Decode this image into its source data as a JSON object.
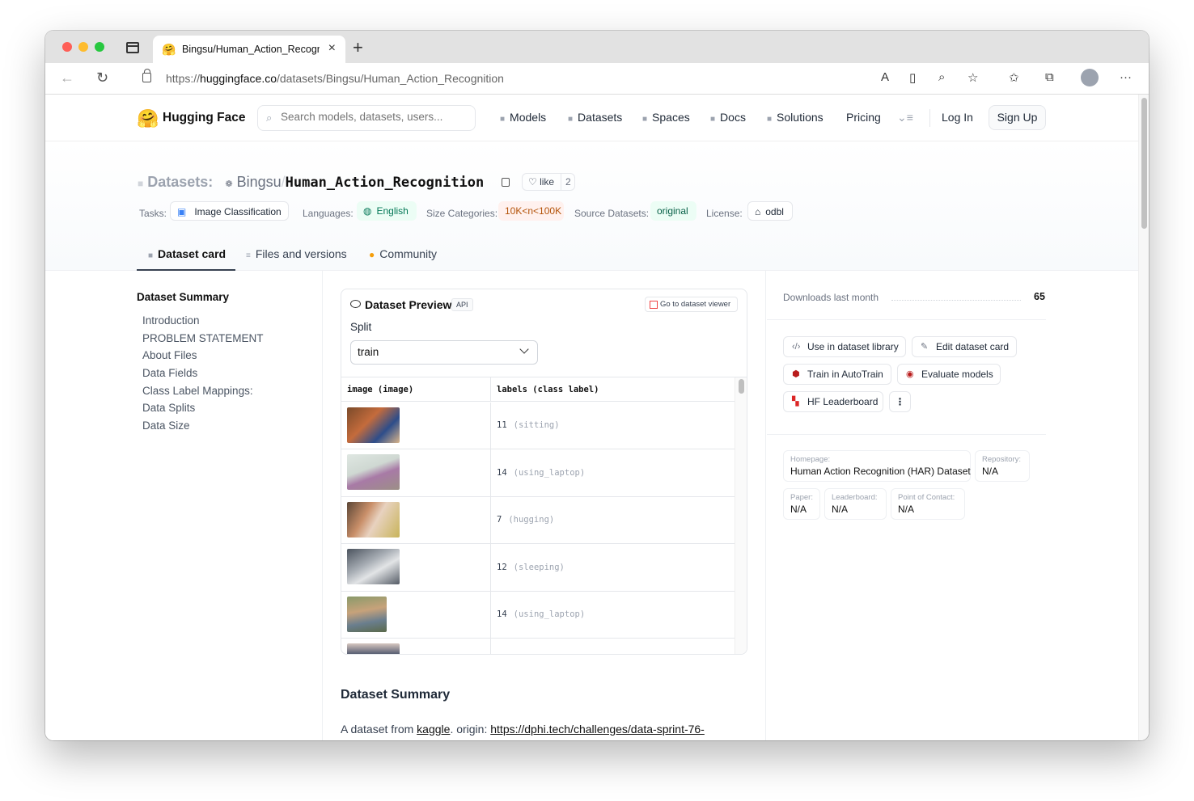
{
  "browser": {
    "tab_title": "Bingsu/Human_Action_Recogn",
    "url_prefix": "https://",
    "url_host": "huggingface.co",
    "url_path": "/datasets/Bingsu/Human_Action_Recognition"
  },
  "hf_nav": {
    "brand": "Hugging Face",
    "search_placeholder": "Search models, datasets, users...",
    "links": [
      "Models",
      "Datasets",
      "Spaces",
      "Docs",
      "Solutions",
      "Pricing"
    ],
    "login": "Log In",
    "signup": "Sign Up"
  },
  "header": {
    "datasets_label": "Datasets:",
    "owner": "Bingsu",
    "separator": "/",
    "name": "Human_Action_Recognition",
    "like_label": "like",
    "like_count": "2",
    "tasks_label": "Tasks:",
    "task": "Image Classification",
    "languages_label": "Languages:",
    "language": "English",
    "size_label": "Size Categories:",
    "size": "10K<n<100K",
    "source_label": "Source Datasets:",
    "source": "original",
    "license_label": "License:",
    "license": "odbl"
  },
  "page_tabs": [
    "Dataset card",
    "Files and versions",
    "Community"
  ],
  "toc": {
    "title": "Dataset Summary",
    "items": [
      "Introduction",
      "PROBLEM STATEMENT",
      "About Files",
      "Data Fields",
      "Class Label Mappings:",
      "Data Splits",
      "Data Size"
    ]
  },
  "preview": {
    "title": "Dataset Preview",
    "api": "API",
    "goto": "Go to dataset viewer",
    "split_label": "Split",
    "split_value": "train",
    "col_image": "image (image)",
    "col_labels": "labels (class label)",
    "rows": [
      {
        "num": "11",
        "cls": "(sitting)"
      },
      {
        "num": "14",
        "cls": "(using_laptop)"
      },
      {
        "num": "7",
        "cls": "(hugging)"
      },
      {
        "num": "12",
        "cls": "(sleeping)"
      },
      {
        "num": "14",
        "cls": "(using_laptop)"
      }
    ]
  },
  "summary": {
    "title": "Dataset Summary",
    "text_prefix": "A dataset from ",
    "kaggle": "kaggle",
    "text_mid": ". origin: ",
    "link": "https://dphi.tech/challenges/data-sprint-76-"
  },
  "right": {
    "downloads_label": "Downloads last month",
    "downloads_value": "65",
    "buttons": [
      "Use in dataset library",
      "Edit dataset card",
      "Train in AutoTrain",
      "Evaluate models",
      "HF Leaderboard",
      "⋮"
    ],
    "homepage_k": "Homepage:",
    "homepage_v": "Human Action Recognition (HAR) Dataset",
    "repo_k": "Repository:",
    "repo_v": "N/A",
    "paper_k": "Paper:",
    "paper_v": "N/A",
    "leader_k": "Leaderboard:",
    "leader_v": "N/A",
    "contact_k": "Point of Contact:",
    "contact_v": "N/A"
  }
}
